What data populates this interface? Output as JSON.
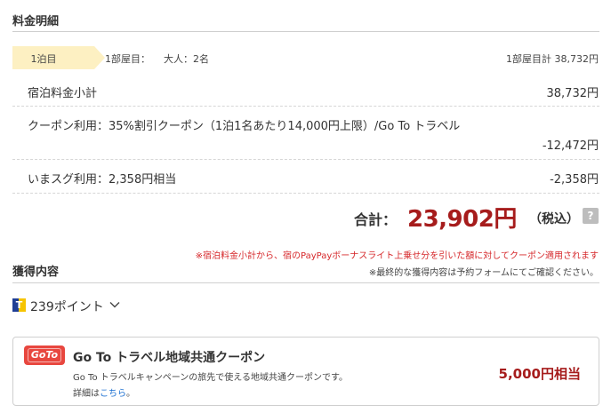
{
  "breakdown": {
    "title": "料金明細",
    "night_label": "1泊目",
    "room_label": "1部屋目：",
    "guests": "大人：2名",
    "room_total": "1部屋目計 38,732円",
    "subtotal_label": "宿泊料金小計",
    "subtotal_value": "38,732円",
    "coupon_label": "クーポン利用：35%割引クーポン（1泊1名あたり14,000円上限）/Go To トラベル",
    "coupon_value": "-12,472円",
    "imasugu_label": "いまスグ利用：2,358円相当",
    "imasugu_value": "-2,358円",
    "total_label": "合計：",
    "total_value": "23,902円",
    "tax_label": "（税込）",
    "help_icon": "?"
  },
  "notes": {
    "red": "※宿泊料金小計から、宿のPayPayボーナスライト上乗せ分を引いた額に対してクーポン適用されます",
    "gray": "※最終的な獲得内容は予約フォームにてご確認ください。"
  },
  "earned": {
    "title": "獲得内容",
    "tpoint_glyph": "T",
    "points": "239ポイント",
    "icon": "chevron-down-icon"
  },
  "goto": {
    "logo_text": "GoTo",
    "title": "Go To トラベル地域共通クーポン",
    "description": "Go To トラベルキャンペーンの旅先で使える地域共通クーポンです。",
    "detail_prefix": "詳細は",
    "detail_link": "こちら",
    "detail_suffix": "。",
    "amount": "5,000円相当"
  },
  "colors": {
    "accent_red": "#a61c1c",
    "note_red": "#d6282b",
    "tag_bg": "#fdf0c2",
    "link": "#1a6fd1",
    "goto_brand": "#e8473f"
  }
}
